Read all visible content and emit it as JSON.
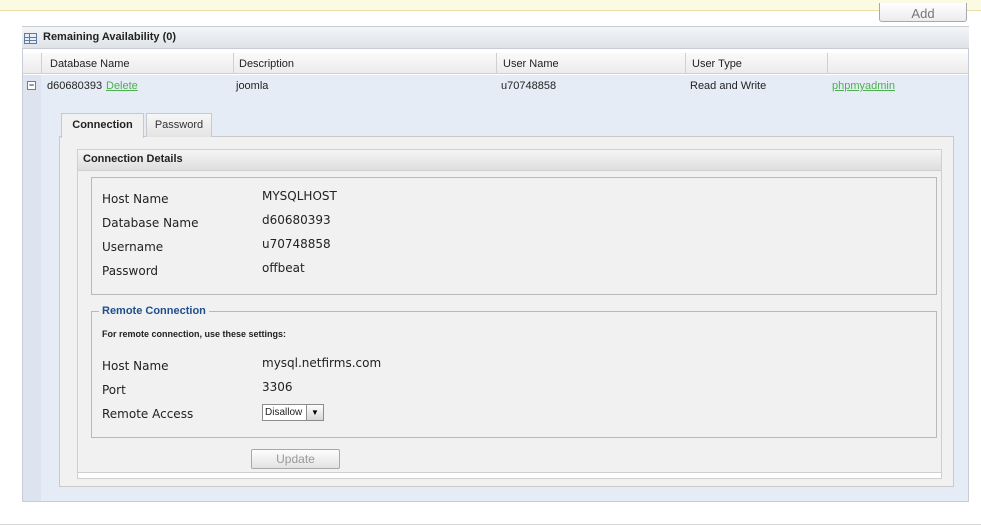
{
  "toolbar": {
    "add_label": "Add"
  },
  "panel": {
    "title": "Remaining Availability (0)"
  },
  "columns": [
    "Database Name",
    "Description",
    "User Name",
    "User Type"
  ],
  "row": {
    "database_name": "d60680393",
    "delete_label": "Delete",
    "description": "joomla",
    "user_name": "u70748858",
    "user_type": "Read and Write",
    "phpmyadmin_label": "phpmyadmin"
  },
  "tabs": [
    {
      "label": "Connection",
      "active": true
    },
    {
      "label": "Password",
      "active": false
    }
  ],
  "connection_details": {
    "title": "Connection Details",
    "fields": [
      {
        "label": "Host Name",
        "value": "MYSQLHOST"
      },
      {
        "label": "Database Name",
        "value": "d60680393"
      },
      {
        "label": "Username",
        "value": "u70748858"
      },
      {
        "label": "Password",
        "value": "offbeat"
      }
    ]
  },
  "remote_connection": {
    "legend": "Remote Connection",
    "hint": "For remote connection, use these settings:",
    "fields": [
      {
        "label": "Host Name",
        "value": "mysql.netfirms.com"
      },
      {
        "label": "Port",
        "value": "3306"
      }
    ],
    "remote_access_label": "Remote Access",
    "remote_access_value": "Disallow"
  },
  "update_label": "Update",
  "colors": {
    "link": "#4caf50",
    "legend": "#1f4e8c",
    "row_bg": "#e6ecf6"
  }
}
